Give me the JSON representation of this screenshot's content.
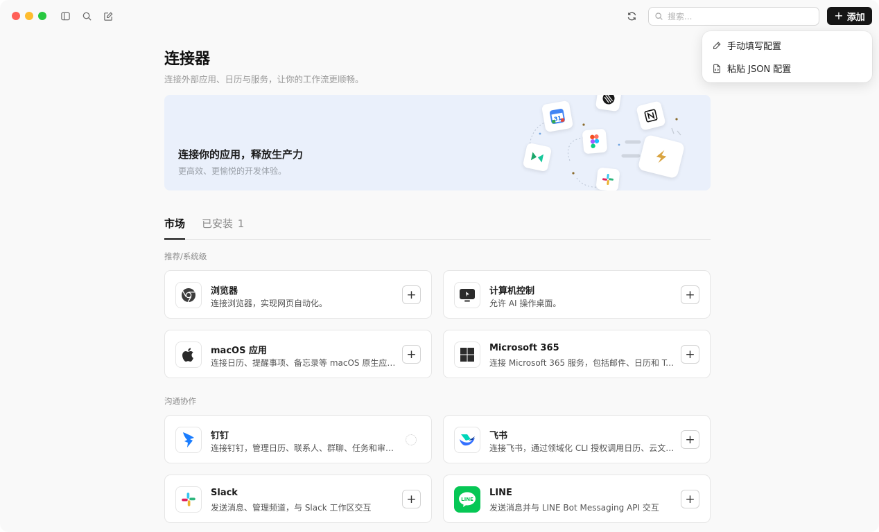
{
  "toolbar": {
    "search_placeholder": "搜索...",
    "add_label": "添加"
  },
  "add_menu": {
    "items": [
      {
        "label": "手动填写配置",
        "icon": "pencil-icon"
      },
      {
        "label": "粘贴 JSON 配置",
        "icon": "paste-file-icon"
      }
    ]
  },
  "page": {
    "title": "连接器",
    "subtitle": "连接外部应用、日历与服务，让你的工作流更顺畅。"
  },
  "banner": {
    "title": "连接你的应用，释放生产力",
    "subtitle": "更高效、更愉悦的开发体验。",
    "icons": [
      "google-calendar-icon",
      "linear-icon",
      "notion-icon",
      "figma-icon",
      "make-icon",
      "slack-icon",
      "plug-icon"
    ]
  },
  "tabs": {
    "market": "市场",
    "installed": "已安装",
    "installed_count": "1"
  },
  "sections": [
    {
      "label": "推荐/系统级",
      "cards": [
        {
          "name": "浏览器",
          "desc": "连接浏览器，实现网页自动化。",
          "icon": "chrome-icon",
          "state": "add"
        },
        {
          "name": "计算机控制",
          "desc": "允许 AI 操作桌面。",
          "icon": "computer-icon",
          "state": "add"
        },
        {
          "name": "macOS 应用",
          "desc": "连接日历、提醒事项、备忘录等 macOS 原生应用。",
          "icon": "apple-icon",
          "state": "add"
        },
        {
          "name": "Microsoft 365",
          "desc": "连接 Microsoft 365 服务，包括邮件、日历和 Tea...",
          "icon": "microsoft-icon",
          "state": "add"
        }
      ]
    },
    {
      "label": "沟通协作",
      "cards": [
        {
          "name": "钉钉",
          "desc": "连接钉钉，管理日历、联系人、群聊、任务和审批...",
          "icon": "dingtalk-icon",
          "state": "loading"
        },
        {
          "name": "飞书",
          "desc": "连接飞书，通过领域化 CLI 授权调用日历、云文档...",
          "icon": "feishu-icon",
          "state": "add"
        },
        {
          "name": "Slack",
          "desc": "发送消息、管理频道，与 Slack 工作区交互",
          "icon": "slack-icon",
          "state": "add"
        },
        {
          "name": "LINE",
          "desc": "发送消息并与 LINE Bot Messaging API 交互",
          "icon": "line-icon",
          "state": "add"
        }
      ]
    }
  ],
  "colors": {
    "accent_dark": "#161616",
    "banner_bg": "#eaf0fb",
    "line_green": "#06c755"
  }
}
